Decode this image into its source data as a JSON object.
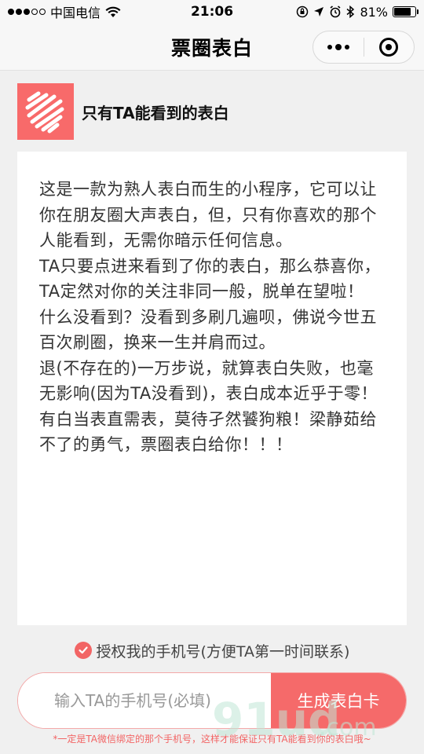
{
  "status_bar": {
    "carrier": "中国电信",
    "time": "21:06",
    "battery": "81%",
    "battery_level": 0.81
  },
  "nav": {
    "title": "票圈表白"
  },
  "header": {
    "title": "只有TA能看到的表白"
  },
  "content": {
    "paragraphs": [
      "这是一款为熟人表白而生的小程序，它可以让你在朋友圈大声表白，但，只有你喜欢的那个人能看到，无需你暗示任何信息。",
      "TA只要点进来看到了你的表白，那么恭喜你，TA定然对你的关注非同一般，脱单在望啦！",
      "什么没看到？没看到多刷几遍呗，佛说今世五百次刷圈，换来一生并肩而过。",
      "退(不存在的)一万步说，就算表白失败，也毫无影响(因为TA没看到)，表白成本近乎于零！",
      "有白当表直需表，莫待孑然饕狗粮！梁静茹给不了的勇气，票圈表白给你！！！"
    ]
  },
  "auth": {
    "label": "授权我的手机号(方便TA第一时间联系)",
    "checked": true
  },
  "form": {
    "phone_placeholder": "输入TA的手机号(必填)",
    "phone_value": "",
    "submit_label": "生成表白卡"
  },
  "note": "*一定是TA微信绑定的那个手机号，这样才能保证只有TA能看到你的表白哦~",
  "colors": {
    "accent": "#f56a6a",
    "page_bg": "#f0f0f0",
    "card_bg": "#ffffff"
  },
  "icons": {
    "logo": "scribble-heart-logo",
    "check": "check-circle-icon",
    "more": "more-dots-icon",
    "close": "target-icon"
  }
}
